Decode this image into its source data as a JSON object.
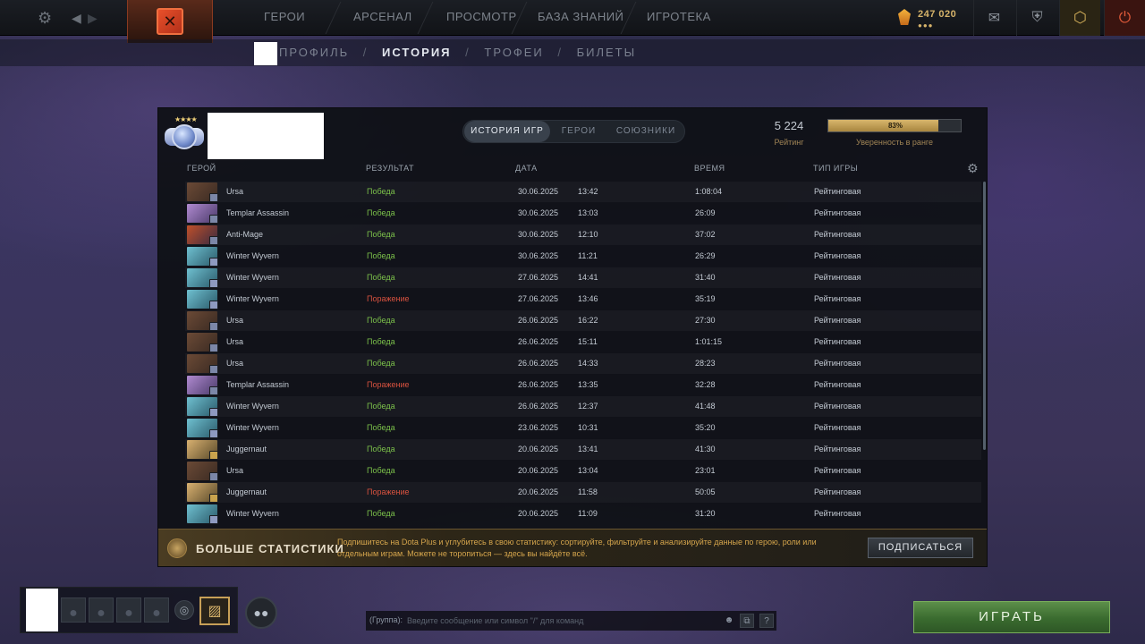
{
  "topbar": {
    "nav": [
      "ГЕРОИ",
      "АРСЕНАЛ",
      "ПРОСМОТР",
      "БАЗА ЗНАНИЙ",
      "ИГРОТЕКА"
    ],
    "shards_amount": "247 020",
    "shards_dots": "●●●"
  },
  "subnav": {
    "profile": "ПРОФИЛЬ",
    "history": "ИСТОРИЯ",
    "trophies": "ТРОФЕИ",
    "tickets": "БИЛЕТЫ",
    "sep": "/"
  },
  "header": {
    "tabs": [
      "ИСТОРИЯ ИГР",
      "ГЕРОИ",
      "СОЮЗНИКИ"
    ],
    "active_tab": 0,
    "rating_value": "5 224",
    "rating_label": "Рейтинг",
    "confidence_percent": 83,
    "confidence_text": "83%",
    "confidence_label": "Уверенность в ранге"
  },
  "table": {
    "columns": [
      "ГЕРОЙ",
      "РЕЗУЛЬТАТ",
      "ДАТА",
      "ВРЕМЯ",
      "ТИП ИГРЫ"
    ],
    "rows": [
      {
        "hero": "Ursa",
        "result": "Победа",
        "win": true,
        "date": "30.06.2025",
        "time": "13:42",
        "duration": "1:08:04",
        "type": "Рейтинговая"
      },
      {
        "hero": "Templar Assassin",
        "result": "Победа",
        "win": true,
        "date": "30.06.2025",
        "time": "13:03",
        "duration": "26:09",
        "type": "Рейтинговая"
      },
      {
        "hero": "Anti-Mage",
        "result": "Победа",
        "win": true,
        "date": "30.06.2025",
        "time": "12:10",
        "duration": "37:02",
        "type": "Рейтинговая"
      },
      {
        "hero": "Winter Wyvern",
        "result": "Победа",
        "win": true,
        "date": "30.06.2025",
        "time": "11:21",
        "duration": "26:29",
        "type": "Рейтинговая"
      },
      {
        "hero": "Winter Wyvern",
        "result": "Победа",
        "win": true,
        "date": "27.06.2025",
        "time": "14:41",
        "duration": "31:40",
        "type": "Рейтинговая"
      },
      {
        "hero": "Winter Wyvern",
        "result": "Поражение",
        "win": false,
        "date": "27.06.2025",
        "time": "13:46",
        "duration": "35:19",
        "type": "Рейтинговая"
      },
      {
        "hero": "Ursa",
        "result": "Победа",
        "win": true,
        "date": "26.06.2025",
        "time": "16:22",
        "duration": "27:30",
        "type": "Рейтинговая"
      },
      {
        "hero": "Ursa",
        "result": "Победа",
        "win": true,
        "date": "26.06.2025",
        "time": "15:11",
        "duration": "1:01:15",
        "type": "Рейтинговая"
      },
      {
        "hero": "Ursa",
        "result": "Победа",
        "win": true,
        "date": "26.06.2025",
        "time": "14:33",
        "duration": "28:23",
        "type": "Рейтинговая"
      },
      {
        "hero": "Templar Assassin",
        "result": "Поражение",
        "win": false,
        "date": "26.06.2025",
        "time": "13:35",
        "duration": "32:28",
        "type": "Рейтинговая"
      },
      {
        "hero": "Winter Wyvern",
        "result": "Победа",
        "win": true,
        "date": "26.06.2025",
        "time": "12:37",
        "duration": "41:48",
        "type": "Рейтинговая"
      },
      {
        "hero": "Winter Wyvern",
        "result": "Победа",
        "win": true,
        "date": "23.06.2025",
        "time": "10:31",
        "duration": "35:20",
        "type": "Рейтинговая"
      },
      {
        "hero": "Juggernaut",
        "result": "Победа",
        "win": true,
        "date": "20.06.2025",
        "time": "13:41",
        "duration": "41:30",
        "type": "Рейтинговая"
      },
      {
        "hero": "Ursa",
        "result": "Победа",
        "win": true,
        "date": "20.06.2025",
        "time": "13:04",
        "duration": "23:01",
        "type": "Рейтинговая"
      },
      {
        "hero": "Juggernaut",
        "result": "Поражение",
        "win": false,
        "date": "20.06.2025",
        "time": "11:58",
        "duration": "50:05",
        "type": "Рейтинговая"
      },
      {
        "hero": "Winter Wyvern",
        "result": "Победа",
        "win": true,
        "date": "20.06.2025",
        "time": "11:09",
        "duration": "31:20",
        "type": "Рейтинговая"
      }
    ]
  },
  "plus": {
    "title": "БОЛЬШЕ СТАТИСТИКИ",
    "text": "Подпишитесь на Dota Plus и углубитесь в свою статистику: сортируйте, фильтруйте и анализируйте данные по герою, роли или отдельным играм. Можете не торопиться — здесь вы найдёте всё.",
    "button": "ПОДПИСАТЬСЯ"
  },
  "chat": {
    "channel": "(Группа):",
    "placeholder": "Введите сообщение или символ \"/\" для команд"
  },
  "play_label": "ИГРАТЬ",
  "colors": {
    "win": "#7bc04a",
    "loss": "#d9523f",
    "accent_gold": "#d6b36a",
    "play_green": "#3a6b2f"
  }
}
